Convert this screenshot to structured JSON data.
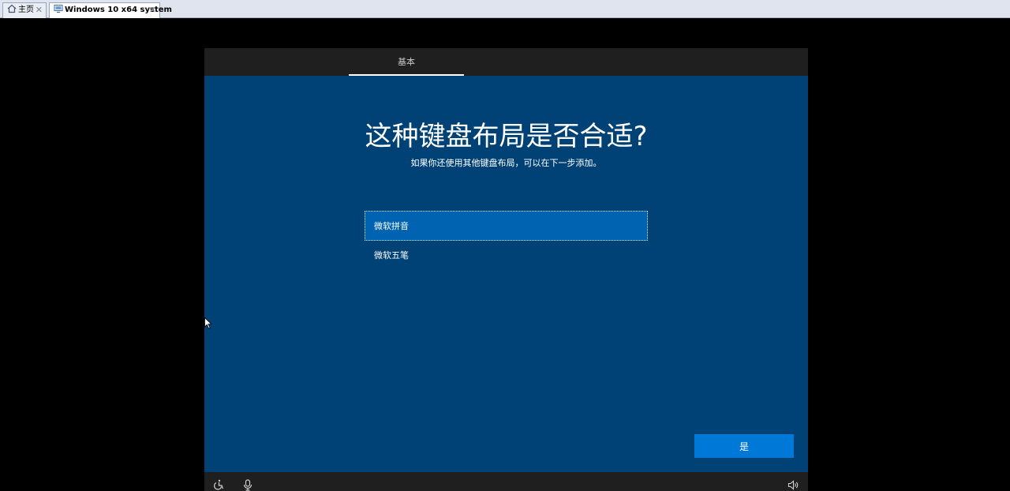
{
  "tabs": [
    {
      "label": "主页",
      "icon": "home-icon",
      "active": false
    },
    {
      "label": "Windows 10 x64 system",
      "icon": "vm-icon",
      "active": true
    }
  ],
  "oobe": {
    "step": "基本",
    "title": "这种键盘布局是否合适?",
    "subtitle": "如果你还使用其他键盘布局，可以在下一步添加。",
    "layouts": [
      {
        "label": "微软拼音",
        "selected": true
      },
      {
        "label": "微软五笔",
        "selected": false
      }
    ],
    "yes_label": "是",
    "footer_icons": [
      "ease-of-access-icon",
      "microphone-icon",
      "volume-icon"
    ]
  },
  "colors": {
    "oobe_background": "#004275",
    "selected_item": "#0063b1",
    "primary_button": "#0078d7",
    "header_footer": "#1f1f1f"
  }
}
